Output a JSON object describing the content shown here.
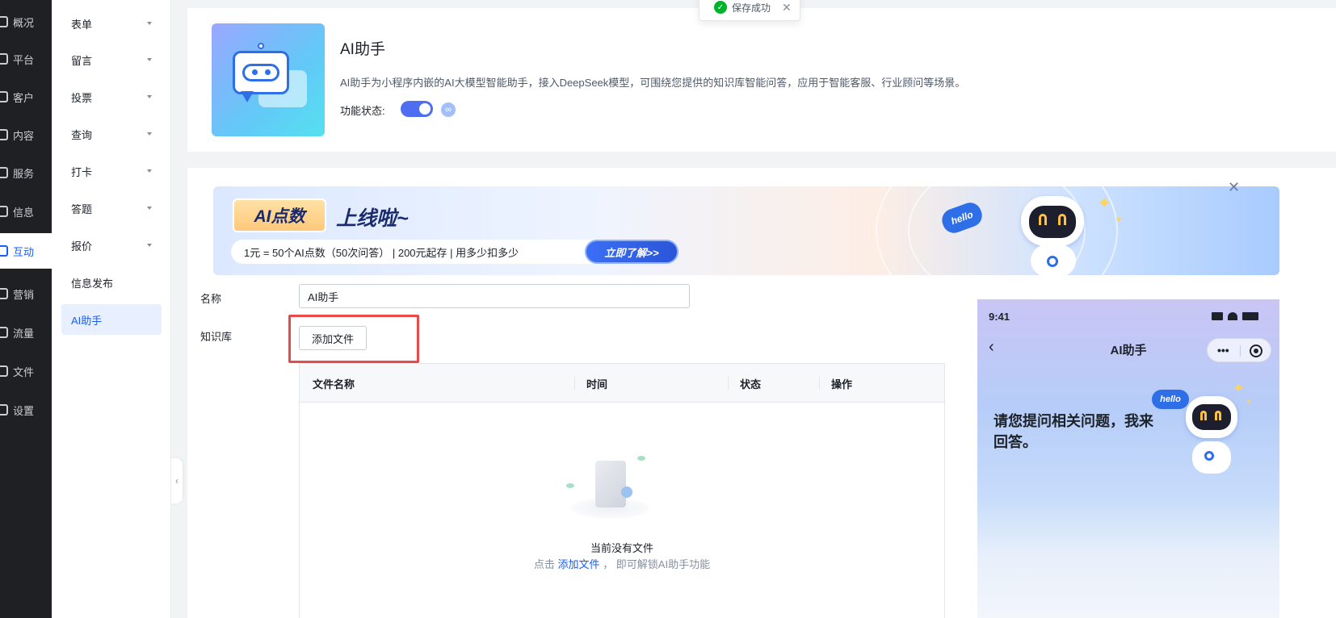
{
  "toast": {
    "text": "保存成功",
    "close": "✕"
  },
  "rail": {
    "items": [
      {
        "label": "概况",
        "active": false
      },
      {
        "label": "平台",
        "active": false
      },
      {
        "label": "客户",
        "active": false
      },
      {
        "label": "内容",
        "active": false
      },
      {
        "label": "服务",
        "active": false
      },
      {
        "label": "信息",
        "active": false
      },
      {
        "label": "互动",
        "active": true
      },
      {
        "label": "营销",
        "active": false
      },
      {
        "label": "流量",
        "active": false
      },
      {
        "label": "文件",
        "active": false
      },
      {
        "label": "设置",
        "active": false
      }
    ]
  },
  "subnav": {
    "items": [
      {
        "label": "表单",
        "expandable": true
      },
      {
        "label": "留言",
        "expandable": true
      },
      {
        "label": "投票",
        "expandable": true
      },
      {
        "label": "查询",
        "expandable": true
      },
      {
        "label": "打卡",
        "expandable": true
      },
      {
        "label": "答题",
        "expandable": true
      },
      {
        "label": "报价",
        "expandable": true
      },
      {
        "label": "信息发布",
        "expandable": false
      },
      {
        "label": "AI助手",
        "expandable": false,
        "active": true
      }
    ],
    "collapse_icon": "‹"
  },
  "header": {
    "title": "AI助手",
    "description": "AI助手为小程序内嵌的AI大模型智能助手，接入DeepSeek模型，可围绕您提供的知识库智能问答，应用于智能客服、行业顾问等场景。",
    "status_label": "功能状态:",
    "status_on": true,
    "link_icon": "link-icon"
  },
  "banner": {
    "badge": "AI点数",
    "headline": "上线啦~",
    "pricing": "1元 = 50个AI点数（50次问答） | 200元起存 | 用多少扣多少",
    "cta": "立即了解>>",
    "hello": "hello",
    "close": "✕"
  },
  "form": {
    "name_label": "名称",
    "name_value": "AI助手",
    "kb_label": "知识库",
    "add_file_button": "添加文件"
  },
  "file_table": {
    "columns": [
      "文件名称",
      "时间",
      "状态",
      "操作"
    ],
    "rows": [],
    "empty_title": "当前没有文件",
    "empty_hint_prefix": "点击",
    "empty_hint_link": "添加文件",
    "empty_hint_suffix": "， 即可解锁AI助手功能"
  },
  "phone_preview": {
    "time": "9:41",
    "back": "‹",
    "title": "AI助手",
    "menu_dots": "•••",
    "greeting": "请您提问相关问题，我来回答。",
    "hello": "hello"
  },
  "colors": {
    "accent": "#165dff",
    "rail_bg": "#1f2023",
    "toggle_on": "#4e6ef2",
    "highlight_box": "#e8494b",
    "success": "#00b42a"
  }
}
